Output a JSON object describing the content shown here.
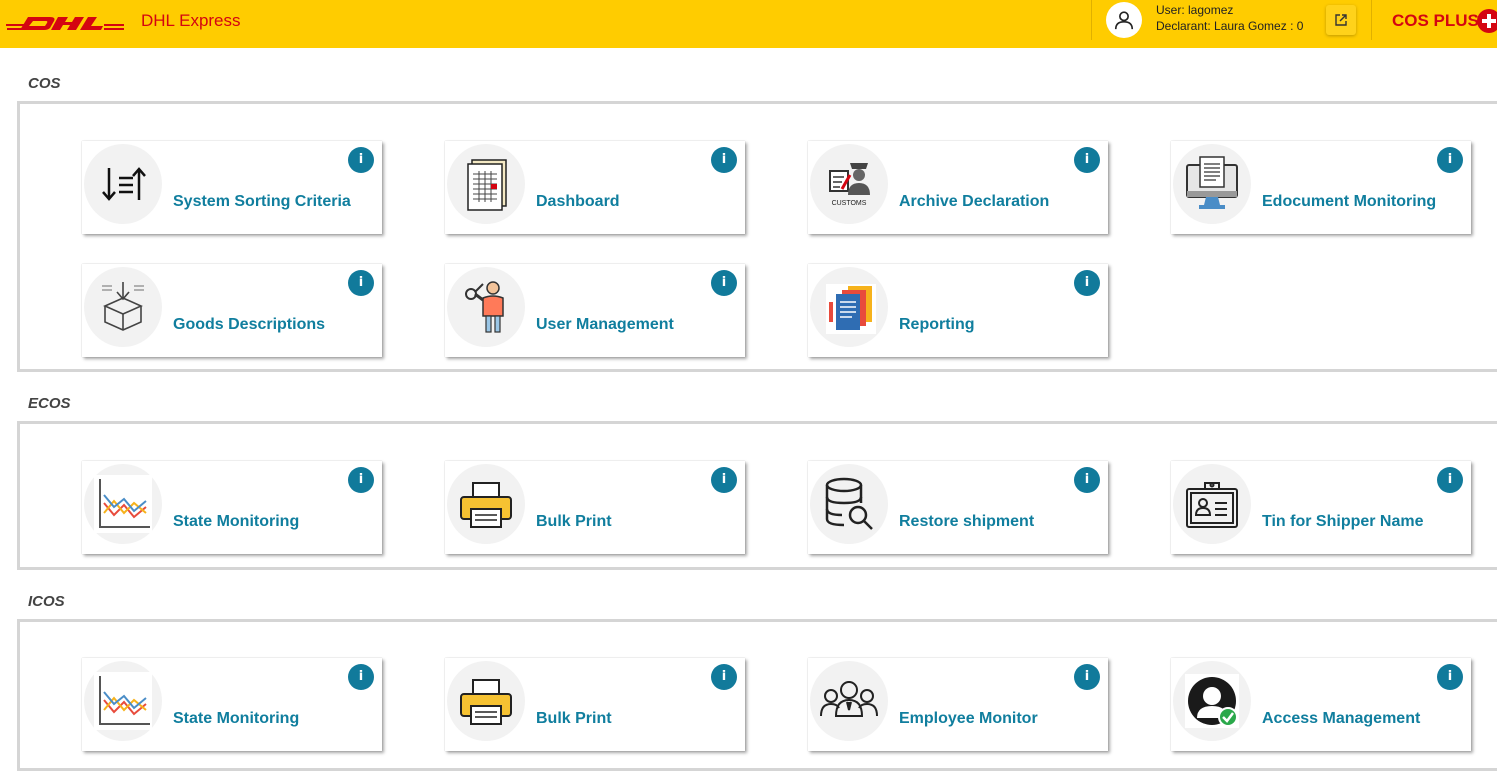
{
  "header": {
    "brand": "DHL Express",
    "user_line": "User: lagomez",
    "declarant_line": "Declarant: Laura Gomez : 0",
    "product": "COS PLUS",
    "colors": {
      "bar": "#ffcc00",
      "brand": "#d40511"
    }
  },
  "sections": [
    {
      "title": "COS",
      "cards": [
        {
          "label": "System Sorting Criteria",
          "icon": "sort-arrows-icon",
          "info": "i"
        },
        {
          "label": "Dashboard",
          "icon": "spreadsheet-icon",
          "info": "i"
        },
        {
          "label": "Archive Declaration",
          "icon": "customs-officer-icon",
          "customs_text": "CUSTOMS",
          "info": "i"
        },
        {
          "label": "Edocument Monitoring",
          "icon": "monitor-document-icon",
          "info": "i"
        },
        {
          "label": "Goods Descriptions",
          "icon": "box-download-icon",
          "info": "i"
        },
        {
          "label": "User Management",
          "icon": "user-key-icon",
          "info": "i"
        },
        {
          "label": "Reporting",
          "icon": "report-folders-icon",
          "info": "i"
        }
      ]
    },
    {
      "title": "ECOS",
      "cards": [
        {
          "label": "State Monitoring",
          "icon": "line-chart-icon",
          "info": "i"
        },
        {
          "label": "Bulk Print",
          "icon": "printer-icon",
          "info": "i"
        },
        {
          "label": "Restore shipment",
          "icon": "database-search-icon",
          "info": "i"
        },
        {
          "label": "Tin for Shipper Name",
          "icon": "id-badge-icon",
          "info": "i"
        }
      ]
    },
    {
      "title": "ICOS",
      "cards": [
        {
          "label": "State Monitoring",
          "icon": "line-chart-icon",
          "info": "i"
        },
        {
          "label": "Bulk Print",
          "icon": "printer-icon",
          "info": "i"
        },
        {
          "label": "Employee Monitor",
          "icon": "employee-group-icon",
          "info": "i"
        },
        {
          "label": "Access Management",
          "icon": "user-check-icon",
          "info": "i"
        }
      ]
    }
  ]
}
